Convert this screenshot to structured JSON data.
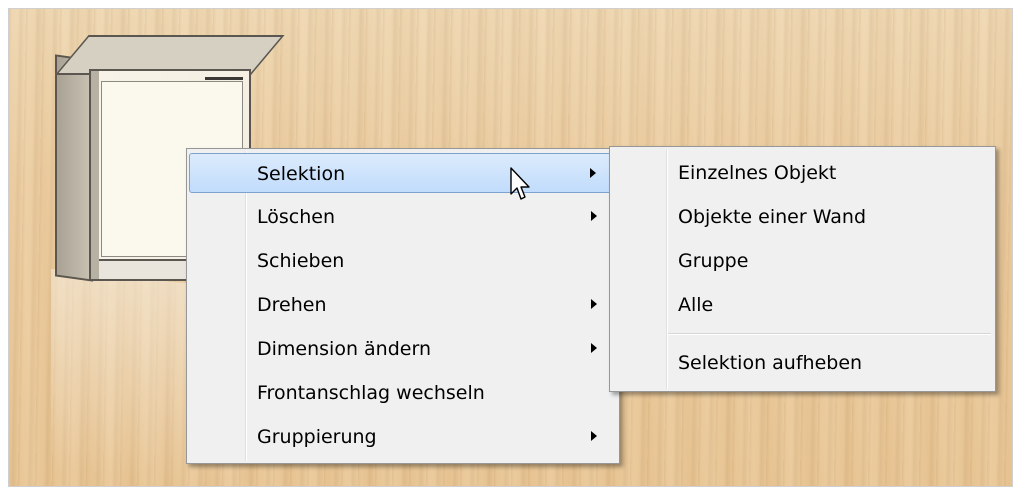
{
  "context_menu": {
    "items": [
      {
        "label": "Selektion",
        "has_submenu": true,
        "highlighted": true
      },
      {
        "label": "Löschen",
        "has_submenu": true
      },
      {
        "label": "Schieben",
        "has_submenu": false
      },
      {
        "label": "Drehen",
        "has_submenu": true
      },
      {
        "label": "Dimension ändern",
        "has_submenu": true
      },
      {
        "label": "Frontanschlag wechseln",
        "has_submenu": false
      },
      {
        "label": "Gruppierung",
        "has_submenu": true
      }
    ]
  },
  "submenu": {
    "items": [
      {
        "label": "Einzelnes Objekt"
      },
      {
        "label": "Objekte einer Wand"
      },
      {
        "label": "Gruppe"
      },
      {
        "label": "Alle"
      },
      {
        "label": "Selektion aufheben"
      }
    ]
  },
  "colors": {
    "highlight": "#c1dcfc",
    "menu_background": "#f0f0f0",
    "floor": "#e8c797"
  },
  "icons": {
    "cursor": "arrow-pointer-icon",
    "submenu_arrow": "triangle-right-icon"
  }
}
